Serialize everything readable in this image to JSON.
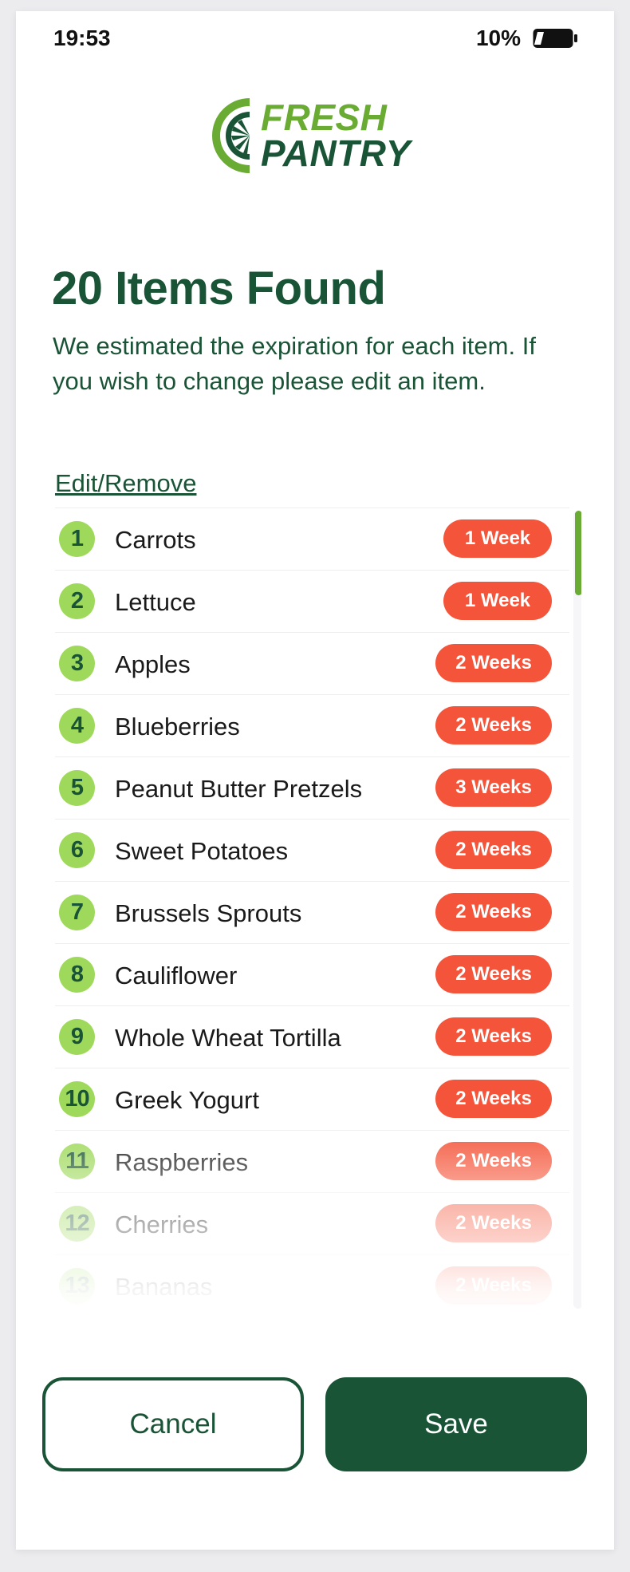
{
  "status_bar": {
    "time": "19:53",
    "battery": "10%"
  },
  "logo": {
    "line1": "FRESH",
    "line2": "PANTRY"
  },
  "header": {
    "title": "20 Items Found",
    "subtitle": "We estimated the expiration for each item. If you wish to change please edit an item."
  },
  "edit_link": "Edit/Remove",
  "items": [
    {
      "num": "1",
      "name": "Carrots",
      "expiry": "1 Week"
    },
    {
      "num": "2",
      "name": "Lettuce",
      "expiry": "1 Week"
    },
    {
      "num": "3",
      "name": "Apples",
      "expiry": "2 Weeks"
    },
    {
      "num": "4",
      "name": "Blueberries",
      "expiry": "2 Weeks"
    },
    {
      "num": "5",
      "name": "Peanut Butter Pretzels",
      "expiry": "3 Weeks"
    },
    {
      "num": "6",
      "name": "Sweet Potatoes",
      "expiry": "2 Weeks"
    },
    {
      "num": "7",
      "name": "Brussels Sprouts",
      "expiry": "2 Weeks"
    },
    {
      "num": "8",
      "name": "Cauliflower",
      "expiry": "2 Weeks"
    },
    {
      "num": "9",
      "name": "Whole Wheat Tortilla",
      "expiry": "2 Weeks"
    },
    {
      "num": "10",
      "name": "Greek Yogurt",
      "expiry": "2 Weeks"
    },
    {
      "num": "11",
      "name": "Raspberries",
      "expiry": "2 Weeks"
    },
    {
      "num": "12",
      "name": "Cherries",
      "expiry": "2 Weeks"
    },
    {
      "num": "13",
      "name": "Bananas",
      "expiry": "2 Weeks"
    }
  ],
  "buttons": {
    "cancel": "Cancel",
    "save": "Save"
  },
  "colors": {
    "primary": "#1a5436",
    "accent": "#6aab33",
    "badge": "#9fd95c",
    "expiry": "#f4553a"
  }
}
